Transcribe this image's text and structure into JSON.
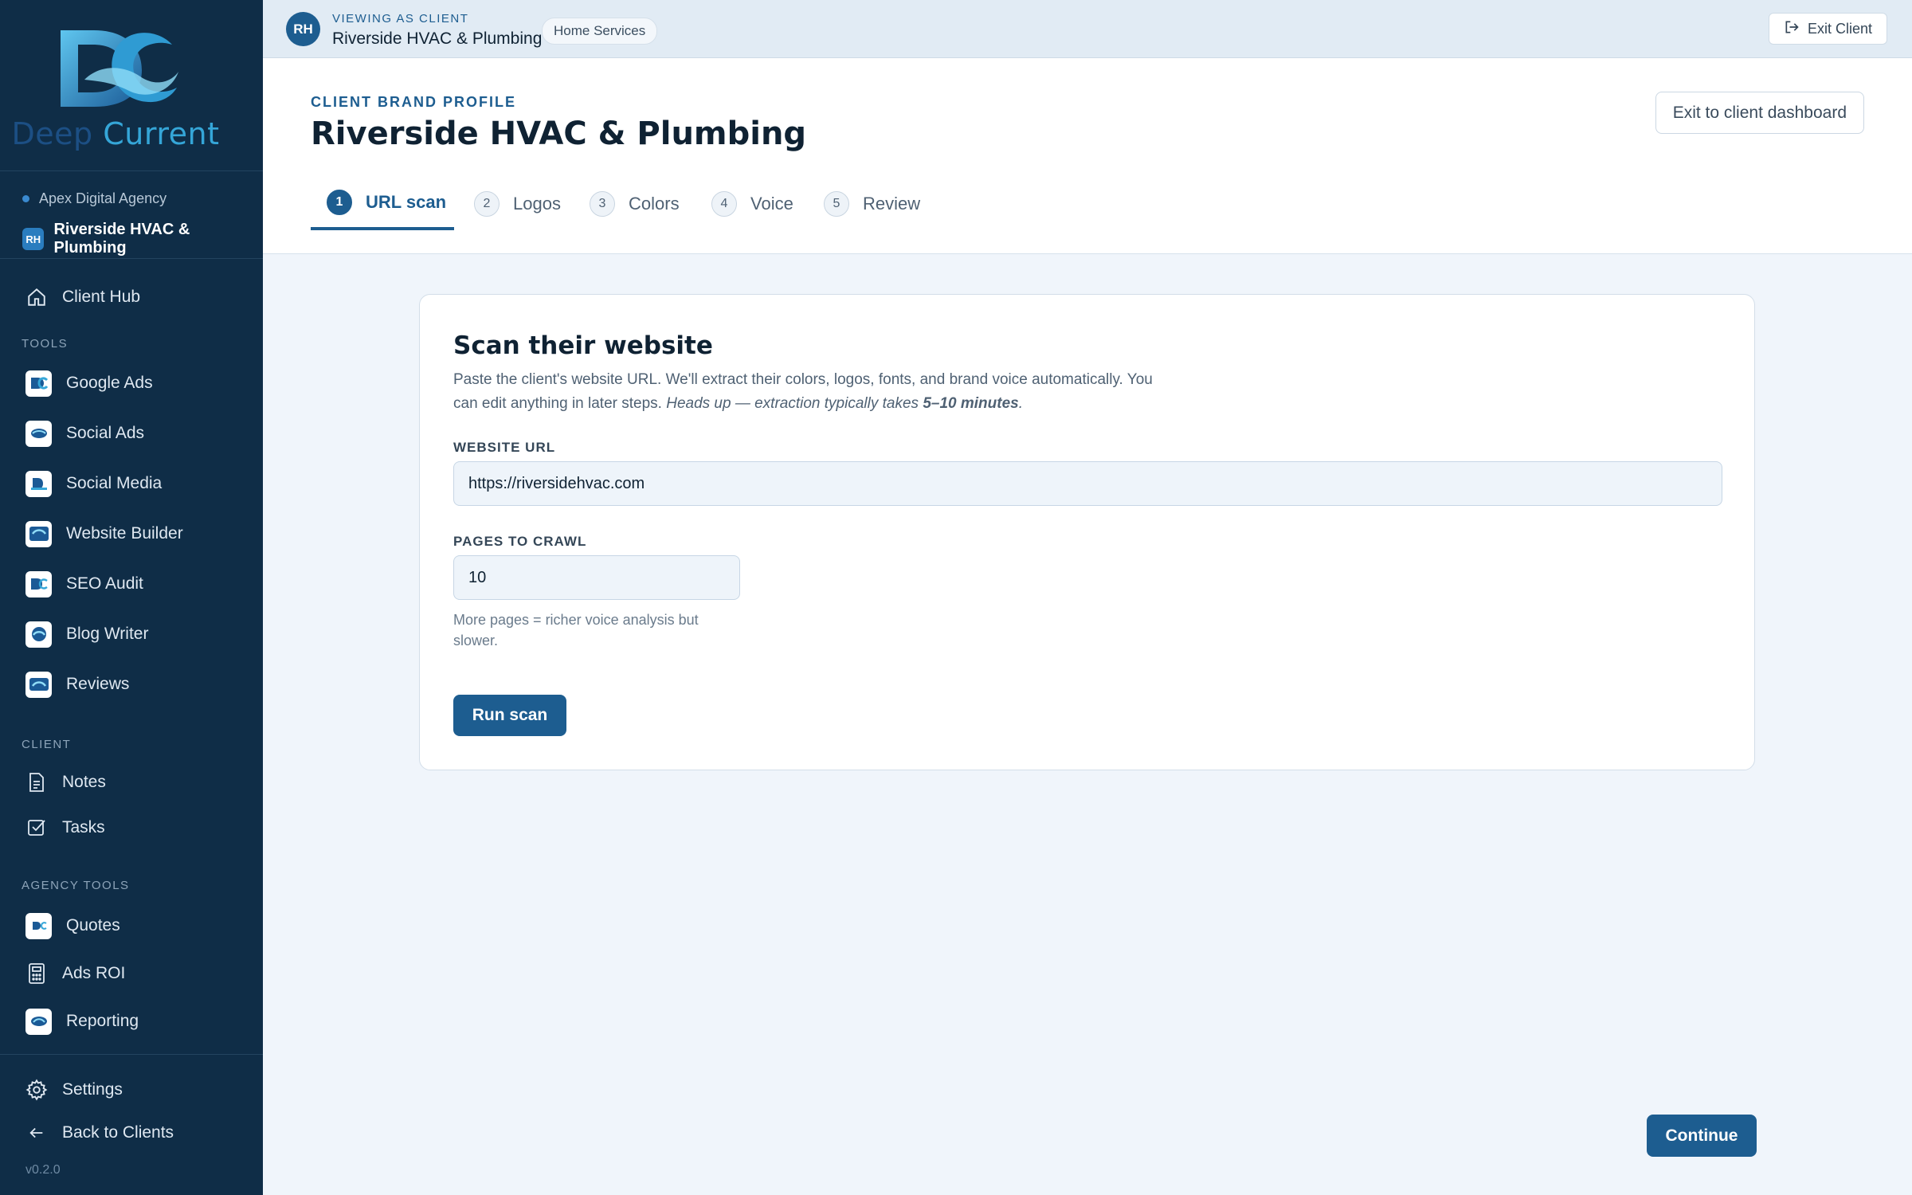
{
  "brand": {
    "name_part1": "Deep",
    "name_part2": "Current"
  },
  "sidebar": {
    "agency": "Apex Digital Agency",
    "client": {
      "initials": "RH",
      "name": "Riverside HVAC & Plumbing"
    },
    "hub": {
      "label": "Client Hub",
      "icon": "home-icon"
    },
    "tools_label": "TOOLS",
    "tools": [
      {
        "label": "Google Ads"
      },
      {
        "label": "Social Ads"
      },
      {
        "label": "Social Media"
      },
      {
        "label": "Website Builder"
      },
      {
        "label": "SEO Audit"
      },
      {
        "label": "Blog Writer"
      },
      {
        "label": "Reviews"
      }
    ],
    "client_label": "CLIENT",
    "client_items": [
      {
        "label": "Notes",
        "icon": "document-icon"
      },
      {
        "label": "Tasks",
        "icon": "checkbox-icon"
      }
    ],
    "agency_tools_label": "AGENCY TOOLS",
    "agency_tools": [
      {
        "label": "Quotes"
      },
      {
        "label": "Ads ROI",
        "icon": "calculator-icon"
      },
      {
        "label": "Reporting"
      }
    ],
    "settings": "Settings",
    "back": "Back to Clients",
    "version": "v0.2.0"
  },
  "topbar": {
    "avatar": "RH",
    "viewing_label": "VIEWING AS CLIENT",
    "client_name": "Riverside HVAC & Plumbing",
    "category": "Home Services",
    "exit_label": "Exit Client"
  },
  "header": {
    "eyebrow": "CLIENT BRAND PROFILE",
    "title": "Riverside HVAC & Plumbing",
    "exit_dashboard": "Exit to client dashboard",
    "tabs": [
      {
        "num": "1",
        "label": "URL scan",
        "active": true
      },
      {
        "num": "2",
        "label": "Logos",
        "active": false
      },
      {
        "num": "3",
        "label": "Colors",
        "active": false
      },
      {
        "num": "4",
        "label": "Voice",
        "active": false
      },
      {
        "num": "5",
        "label": "Review",
        "active": false
      }
    ]
  },
  "scan": {
    "title": "Scan their website",
    "desc_plain": "Paste the client's website URL. We'll extract their colors, logos, fonts, and brand voice automatically. You can edit anything in later steps. ",
    "desc_italic": "Heads up — extraction typically takes ",
    "desc_bold": "5–10 minutes",
    "desc_end": ".",
    "url_label": "WEBSITE URL",
    "url_value": "https://riversidehvac.com",
    "pages_label": "PAGES TO CRAWL",
    "pages_value": "10",
    "help": "More pages = richer voice analysis but slower.",
    "run_label": "Run scan"
  },
  "footer": {
    "continue_label": "Continue"
  },
  "colors": {
    "sidebar_bg": "#0f2d47",
    "accent": "#1d5d90",
    "page_bg": "#f0f5fb"
  }
}
